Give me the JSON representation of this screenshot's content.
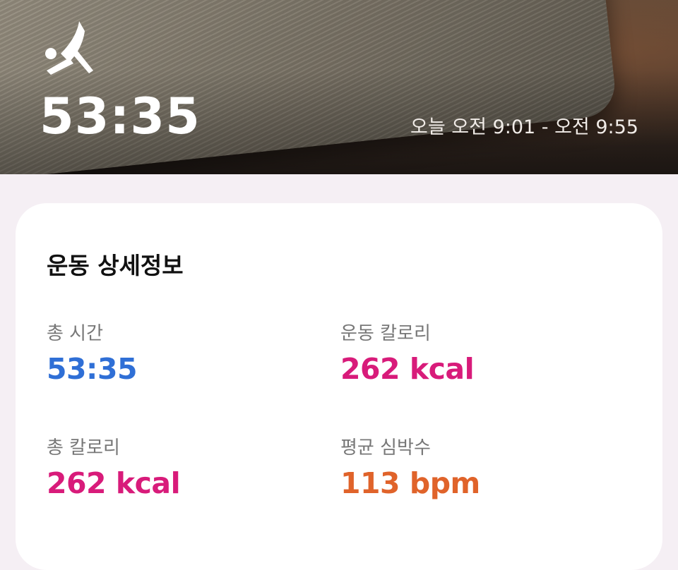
{
  "header": {
    "icon": "yoga-icon",
    "duration": "53:35",
    "time_range": "오늘 오전 9:01 - 오전 9:55"
  },
  "details": {
    "title": "운동 상세정보",
    "stats": [
      {
        "label": "총 시간",
        "value": "53:35",
        "color": "#2f6fd6"
      },
      {
        "label": "운동 칼로리",
        "value": "262 kcal",
        "color": "#d81b7a"
      },
      {
        "label": "총 칼로리",
        "value": "262 kcal",
        "color": "#d81b7a"
      },
      {
        "label": "평균 심박수",
        "value": "113 bpm",
        "color": "#e0632a"
      }
    ]
  },
  "colors": {
    "duration_blue": "#2f6fd6",
    "calorie_pink": "#d81b7a",
    "heart_orange": "#e0632a",
    "background": "#f5eff4"
  }
}
